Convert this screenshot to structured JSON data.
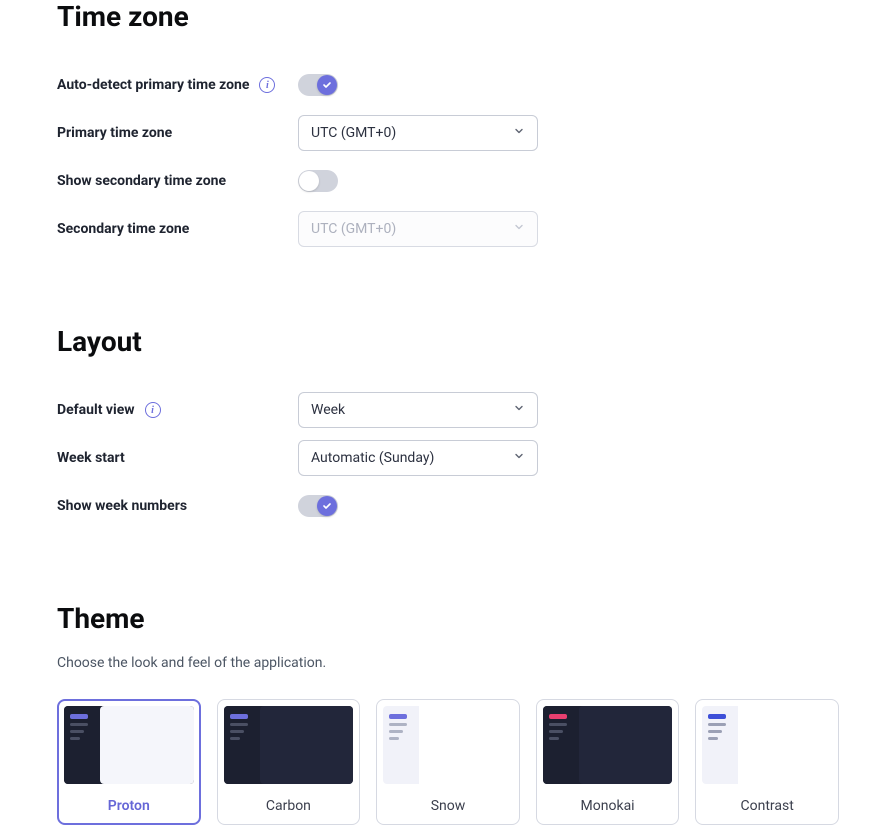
{
  "timezone": {
    "title": "Time zone",
    "auto_detect_label": "Auto-detect primary time zone",
    "auto_detect_on": true,
    "primary_label": "Primary time zone",
    "primary_value": "UTC (GMT+0)",
    "show_secondary_label": "Show secondary time zone",
    "show_secondary_on": false,
    "secondary_label": "Secondary time zone",
    "secondary_value": "UTC (GMT+0)"
  },
  "layout": {
    "title": "Layout",
    "default_view_label": "Default view",
    "default_view_value": "Week",
    "week_start_label": "Week start",
    "week_start_value": "Automatic (Sunday)",
    "week_numbers_label": "Show week numbers",
    "week_numbers_on": true
  },
  "theme": {
    "title": "Theme",
    "description": "Choose the look and feel of the application.",
    "selected": "Proton",
    "options": [
      {
        "id": "proton",
        "name": "Proton"
      },
      {
        "id": "carbon",
        "name": "Carbon"
      },
      {
        "id": "snow",
        "name": "Snow"
      },
      {
        "id": "monokai",
        "name": "Monokai"
      },
      {
        "id": "contrast",
        "name": "Contrast"
      }
    ]
  }
}
